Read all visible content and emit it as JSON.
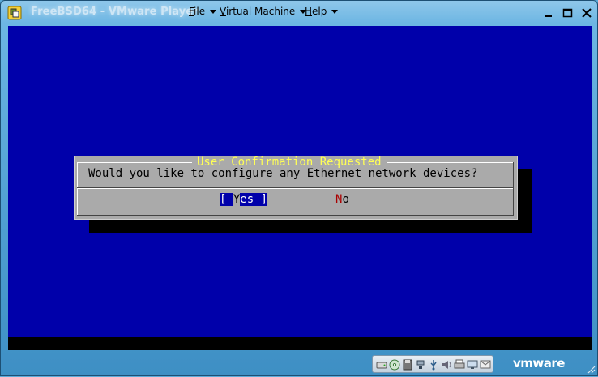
{
  "window": {
    "title": "FreeBSD64 - VMware Player",
    "menus": [
      {
        "label": "File"
      },
      {
        "label": "Virtual Machine"
      },
      {
        "label": "Help"
      }
    ],
    "controls": [
      "minimize-icon",
      "maximize-icon",
      "close-icon"
    ]
  },
  "dialog": {
    "title": "User Confirmation Requested",
    "question": "Would you like to configure any Ethernet network devices?",
    "yes_label": "[ Yes ]",
    "no_label": "No"
  },
  "statusbar": {
    "devices": [
      "hard-disk-icon",
      "cd-dvd-icon",
      "floppy-icon",
      "network-adapter-icon",
      "usb-icon",
      "sound-icon",
      "printer-icon",
      "display-icon",
      "message-icon"
    ],
    "brand": "vmware"
  },
  "colors": {
    "guest_background": "#0000aa",
    "dialog_background": "#aaaaaa",
    "dialog_title": "#ffff55",
    "hotkey_red": "#aa0000"
  }
}
